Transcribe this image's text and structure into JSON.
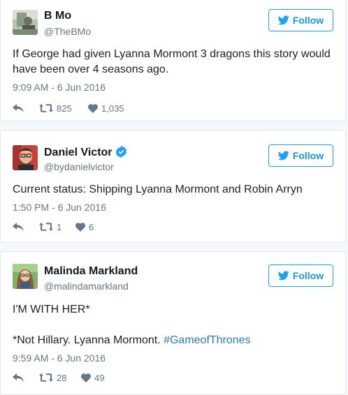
{
  "colors": {
    "accent": "#1da1f2",
    "link": "#2b7bb9",
    "verified": "#1da1f2",
    "muted": "#657786"
  },
  "tweets": [
    {
      "name": "B Mo",
      "handle": "@TheBMo",
      "verified": false,
      "follow_label": "Follow",
      "text_lines": [
        "If George had given Lyanna Mormont 3 dragons this story would have been over 4 seasons ago."
      ],
      "timestamp": "9:09 AM - 6 Jun 2016",
      "retweets": "825",
      "likes": "1,035"
    },
    {
      "name": "Daniel Victor",
      "handle": "@bydanielvictor",
      "verified": true,
      "follow_label": "Follow",
      "text_lines": [
        "Current status: Shipping Lyanna Mormont and Robin Arryn"
      ],
      "timestamp": "1:50 PM - 6 Jun 2016",
      "retweets": "1",
      "likes": "6"
    },
    {
      "name": "Malinda Markland",
      "handle": "@malindamarkland",
      "verified": false,
      "follow_label": "Follow",
      "text_lines": [
        "I'M WITH HER*",
        "*Not Hillary. Lyanna Mormont. "
      ],
      "hashtag": "#GameofThrones",
      "timestamp": "9:59 AM - 6 Jun 2016",
      "retweets": "28",
      "likes": "49"
    }
  ]
}
